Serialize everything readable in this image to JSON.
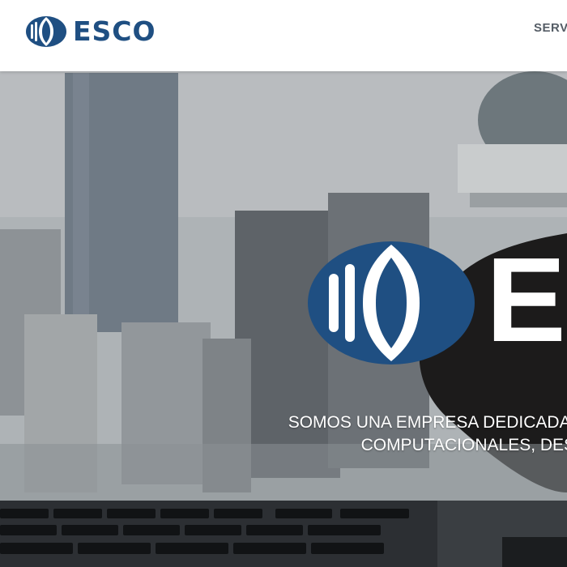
{
  "header": {
    "brand": "ESCO",
    "nav_item": "SERV"
  },
  "hero": {
    "logo_word": "ES",
    "tagline_line1": "SOMOS UNA EMPRESA DEDICADA A ATENDER AL SECTOR EM",
    "tagline_line2": "COMPUTACIONALES, DESARROLLO DE SOF"
  },
  "colors": {
    "brand_blue": "#1f4f82",
    "header_bg": "#ffffff",
    "hero_text": "#ffffff"
  },
  "icons": {
    "logo": "esco-globe-logo"
  }
}
